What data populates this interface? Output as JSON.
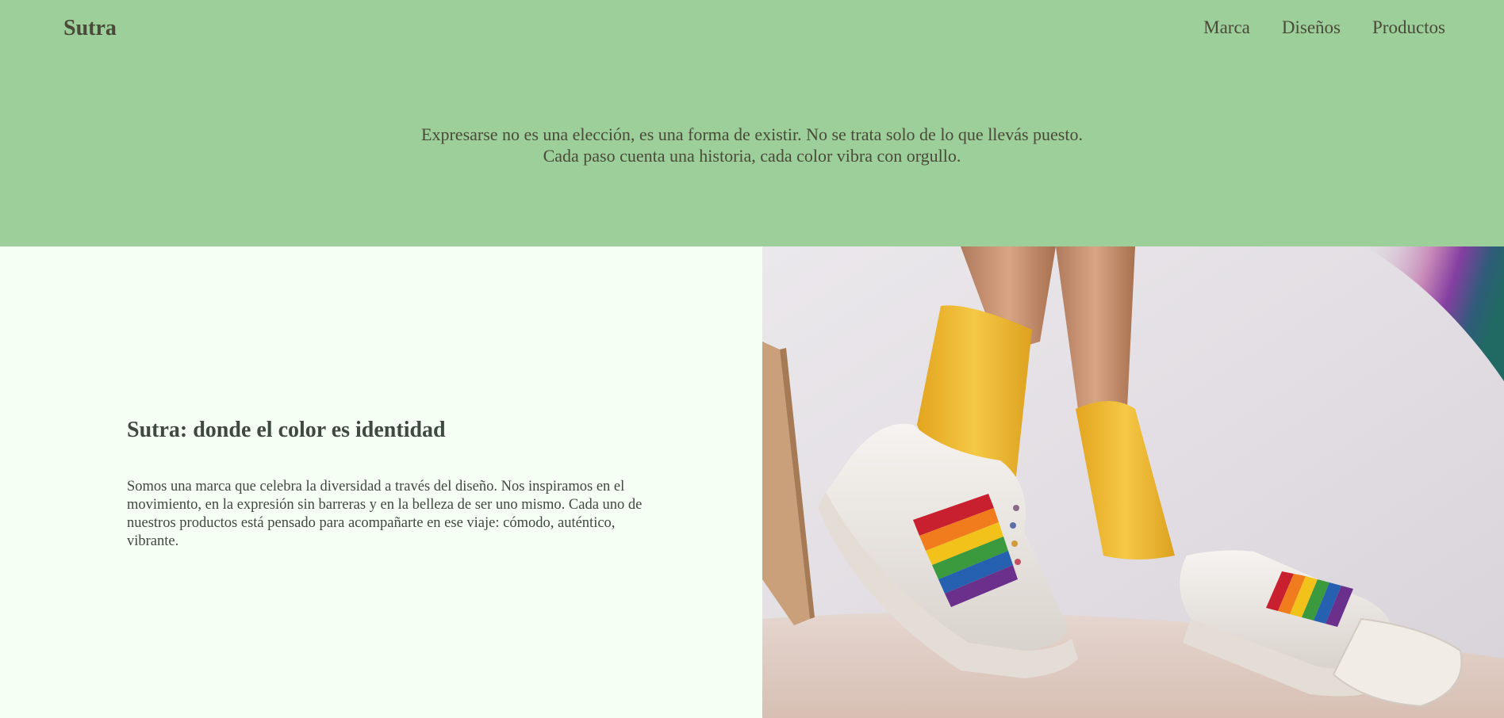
{
  "header": {
    "brand": "Sutra",
    "nav": [
      {
        "label": "Marca"
      },
      {
        "label": "Diseños"
      },
      {
        "label": "Productos"
      }
    ]
  },
  "hero": {
    "line1": "Expresarse no es una elección, es una forma de existir. No se trata solo de lo que llevás puesto.",
    "line2": "Cada paso cuenta una historia, cada color vibra con orgullo."
  },
  "about": {
    "title": "Sutra: donde el color es identidad",
    "body": "Somos una marca que celebra la diversidad a través del diseño. Nos inspiramos en el movimiento, en la expresión sin barreras y en la belleza de ser uno mismo. Cada uno de nuestros productos está pensado para acompañarte en ese viaje: cómodo, auténtico, vibrante."
  },
  "colors": {
    "hero_bg": "#9dcf9b",
    "panel_bg": "#f6fff4",
    "text": "#4a4a38",
    "sock": "#f2c13a"
  }
}
